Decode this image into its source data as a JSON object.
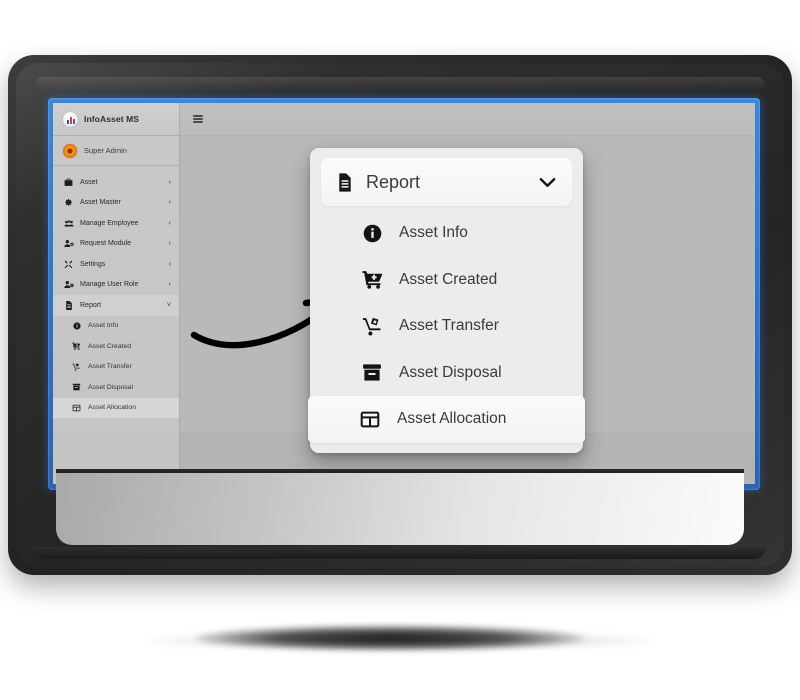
{
  "app": {
    "brand": {
      "name": "InfoAsset MS",
      "logo_icon": "bar-chart-icon"
    },
    "user": {
      "name": "Super Admin",
      "avatar_icon": "user-avatar-icon"
    },
    "topbar": {
      "menu_toggle_icon": "hamburger-icon"
    }
  },
  "sidebar": {
    "items": [
      {
        "label": "Asset",
        "icon": "briefcase-icon",
        "caret": "‹",
        "expanded": false
      },
      {
        "label": "Asset Master",
        "icon": "gear-icon",
        "caret": "‹",
        "expanded": false
      },
      {
        "label": "Manage Employee",
        "icon": "users-icon",
        "caret": "‹",
        "expanded": false
      },
      {
        "label": "Request Module",
        "icon": "user-plus-icon",
        "caret": "‹",
        "expanded": false
      },
      {
        "label": "Settings",
        "icon": "tools-icon",
        "caret": "‹",
        "expanded": false
      },
      {
        "label": "Manage User Role",
        "icon": "user-gear-icon",
        "caret": "‹",
        "expanded": false
      },
      {
        "label": "Report",
        "icon": "document-icon",
        "caret": "˅",
        "expanded": true
      }
    ],
    "report_children": [
      {
        "label": "Asset Info",
        "icon": "info-circle-icon",
        "active": false
      },
      {
        "label": "Asset Created",
        "icon": "cart-plus-icon",
        "active": false
      },
      {
        "label": "Asset Transfer",
        "icon": "hand-truck-icon",
        "active": false
      },
      {
        "label": "Asset Disposal",
        "icon": "box-archive-icon",
        "active": false
      },
      {
        "label": "Asset Allocation",
        "icon": "table-grid-icon",
        "active": true
      }
    ]
  },
  "popup": {
    "header": {
      "title": "Report",
      "icon": "document-icon",
      "chevron_icon": "chevron-down-icon"
    },
    "items": [
      {
        "label": "Asset Info",
        "icon": "info-circle-icon",
        "highlighted": false
      },
      {
        "label": "Asset Created",
        "icon": "cart-plus-icon",
        "highlighted": false
      },
      {
        "label": "Asset Transfer",
        "icon": "hand-truck-icon",
        "highlighted": false
      },
      {
        "label": "Asset Disposal",
        "icon": "box-archive-icon",
        "highlighted": false
      },
      {
        "label": "Asset Allocation",
        "icon": "table-grid-icon",
        "highlighted": true
      }
    ]
  },
  "annotation": {
    "arrow_icon": "curved-arrow-icon"
  },
  "colors": {
    "screen_border": "#2f77cc",
    "bezel": "#2c2c2c",
    "sidebar": "#c6c6c6",
    "desktop": "#b9b9b9",
    "card": "#ececec",
    "card_header": "#f7f7f7",
    "logo_red": "#d23b2e",
    "logo_blue": "#2f6fc0",
    "avatar_orange": "#ef7a18"
  }
}
